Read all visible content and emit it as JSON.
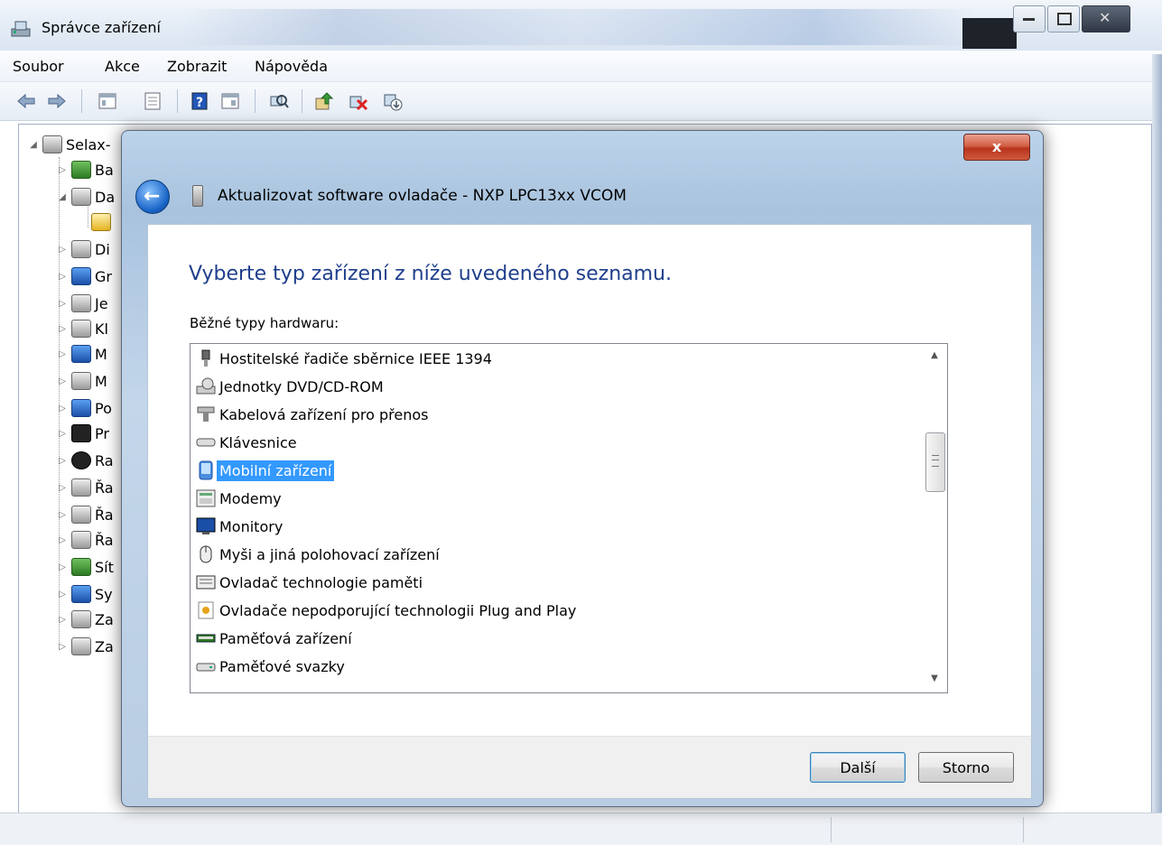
{
  "window": {
    "title": "Správce zařízení",
    "menu": [
      "Soubor",
      "Akce",
      "Zobrazit",
      "Nápověda"
    ]
  },
  "tree": {
    "root": "Selax-",
    "items": [
      {
        "label": "Ba",
        "icon": "battery-icon"
      },
      {
        "label": "Da",
        "icon": "unknown-device-icon"
      },
      {
        "label": "",
        "icon": "warning-device-icon"
      },
      {
        "label": "Di",
        "icon": "disk-drive-icon"
      },
      {
        "label": "Gr",
        "icon": "display-adapter-icon"
      },
      {
        "label": "Je",
        "icon": "dvd-drive-icon"
      },
      {
        "label": "Kl",
        "icon": "keyboard-icon"
      },
      {
        "label": "M",
        "icon": "monitor-icon"
      },
      {
        "label": "M",
        "icon": "mouse-icon"
      },
      {
        "label": "Po",
        "icon": "computer-icon"
      },
      {
        "label": "Pr",
        "icon": "processor-icon"
      },
      {
        "label": "Ra",
        "icon": "bluetooth-icon"
      },
      {
        "label": "Řa",
        "icon": "storage-controller-icon"
      },
      {
        "label": "Řa",
        "icon": "usb-controller-icon"
      },
      {
        "label": "Řa",
        "icon": "sound-icon"
      },
      {
        "label": "Sít",
        "icon": "network-icon"
      },
      {
        "label": "Sy",
        "icon": "system-device-icon"
      },
      {
        "label": "Za",
        "icon": "imaging-device-icon"
      },
      {
        "label": "Za",
        "icon": "printer-icon"
      }
    ]
  },
  "dialog": {
    "close_label": "x",
    "title": "Aktualizovat software ovladače - NXP LPC13xx VCOM",
    "heading": "Vyberte typ zařízení z níže uvedeného seznamu.",
    "list_label": "Běžné typy hardwaru:",
    "items": [
      {
        "label": "Hostitelské řadiče sběrnice IEEE 1394",
        "icon": "firewire-icon"
      },
      {
        "label": "Jednotky DVD/CD-ROM",
        "icon": "dvd-drive-icon"
      },
      {
        "label": "Kabelová zařízení pro přenos",
        "icon": "cable-icon"
      },
      {
        "label": "Klávesnice",
        "icon": "keyboard-icon"
      },
      {
        "label": "Mobilní zařízení",
        "icon": "mobile-device-icon",
        "selected": true
      },
      {
        "label": "Modemy",
        "icon": "modem-icon"
      },
      {
        "label": "Monitory",
        "icon": "monitor-icon"
      },
      {
        "label": "Myši a jiná polohovací zařízení",
        "icon": "mouse-icon"
      },
      {
        "label": "Ovladač technologie paměti",
        "icon": "memory-controller-icon"
      },
      {
        "label": "Ovladače nepodporující technologii Plug and Play",
        "icon": "non-pnp-driver-icon"
      },
      {
        "label": "Paměťová zařízení",
        "icon": "memory-device-icon"
      },
      {
        "label": "Paměťové svazky",
        "icon": "storage-volume-icon"
      }
    ],
    "next_label": "Další",
    "cancel_label": "Storno"
  }
}
